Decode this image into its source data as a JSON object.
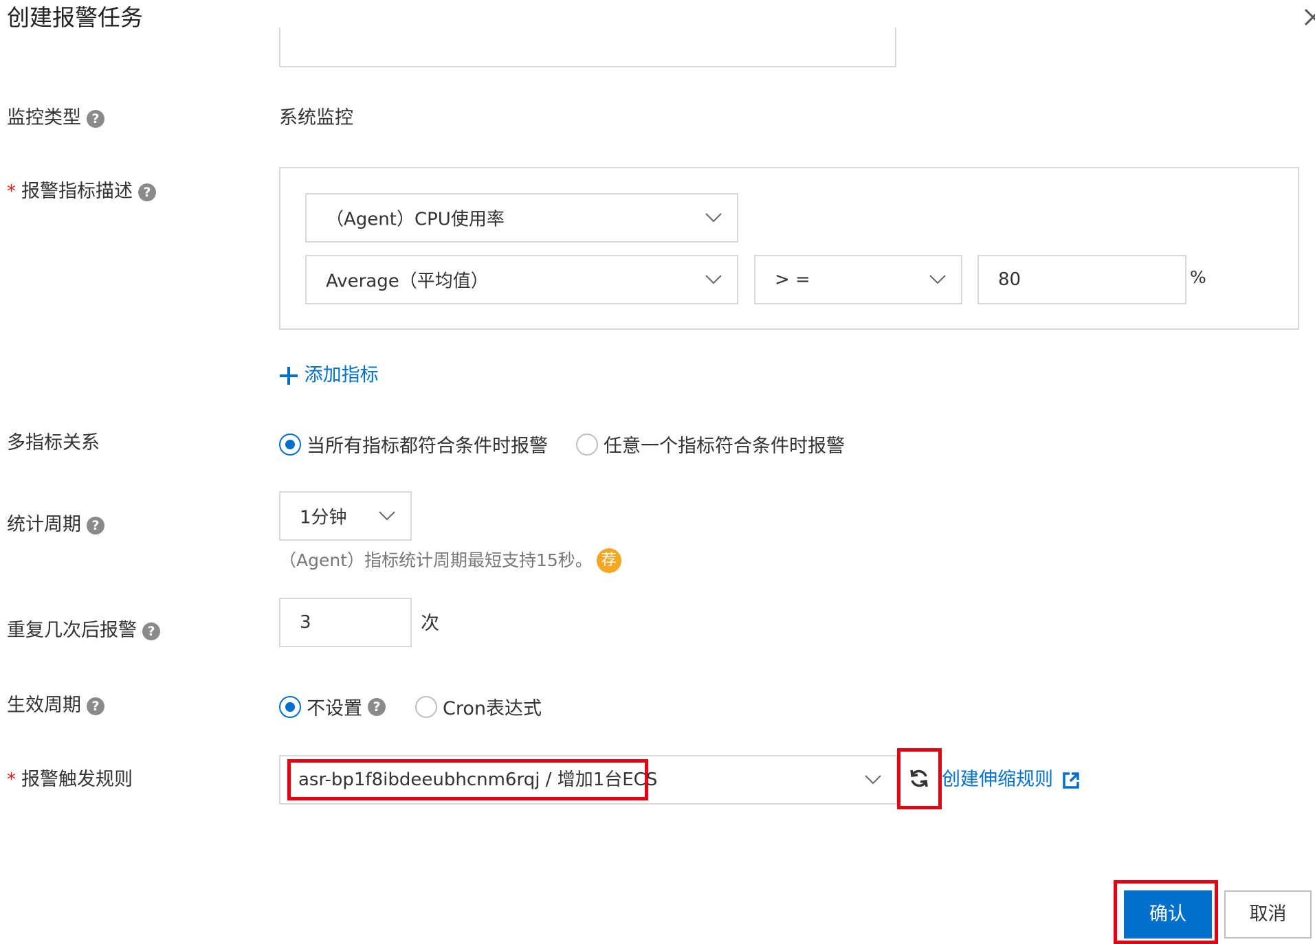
{
  "dialog": {
    "title": "创建报警任务"
  },
  "monitor_type": {
    "label": "监控类型",
    "value": "系统监控"
  },
  "metric_desc": {
    "label": "报警指标描述",
    "metric_select": "（Agent）CPU使用率",
    "stat_select": "Average（平均值）",
    "operator_select": "> =",
    "threshold_value": "80",
    "unit": "%"
  },
  "add_metric": {
    "label": "添加指标"
  },
  "multi_metric": {
    "label": "多指标关系",
    "options": [
      "当所有指标都符合条件时报警",
      "任意一个指标符合条件时报警"
    ],
    "selected": 0
  },
  "period": {
    "label": "统计周期",
    "value": "1分钟",
    "hint": "（Agent）指标统计周期最短支持15秒。",
    "badge": "荐"
  },
  "repeat": {
    "label": "重复几次后报警",
    "value": "3",
    "unit": "次"
  },
  "effective": {
    "label": "生效周期",
    "options": [
      "不设置",
      "Cron表达式"
    ],
    "selected": 0
  },
  "trigger_rule": {
    "label": "报警触发规则",
    "value": "asr-bp1f8ibdeeubhcnm6rqj / 增加1台ECS",
    "create_link": "创建伸缩规则"
  },
  "footer": {
    "confirm": "确认",
    "cancel": "取消"
  },
  "colors": {
    "primary": "#0070cc",
    "highlight": "#e60012",
    "required": "#e02020",
    "badge": "#f5a623"
  }
}
